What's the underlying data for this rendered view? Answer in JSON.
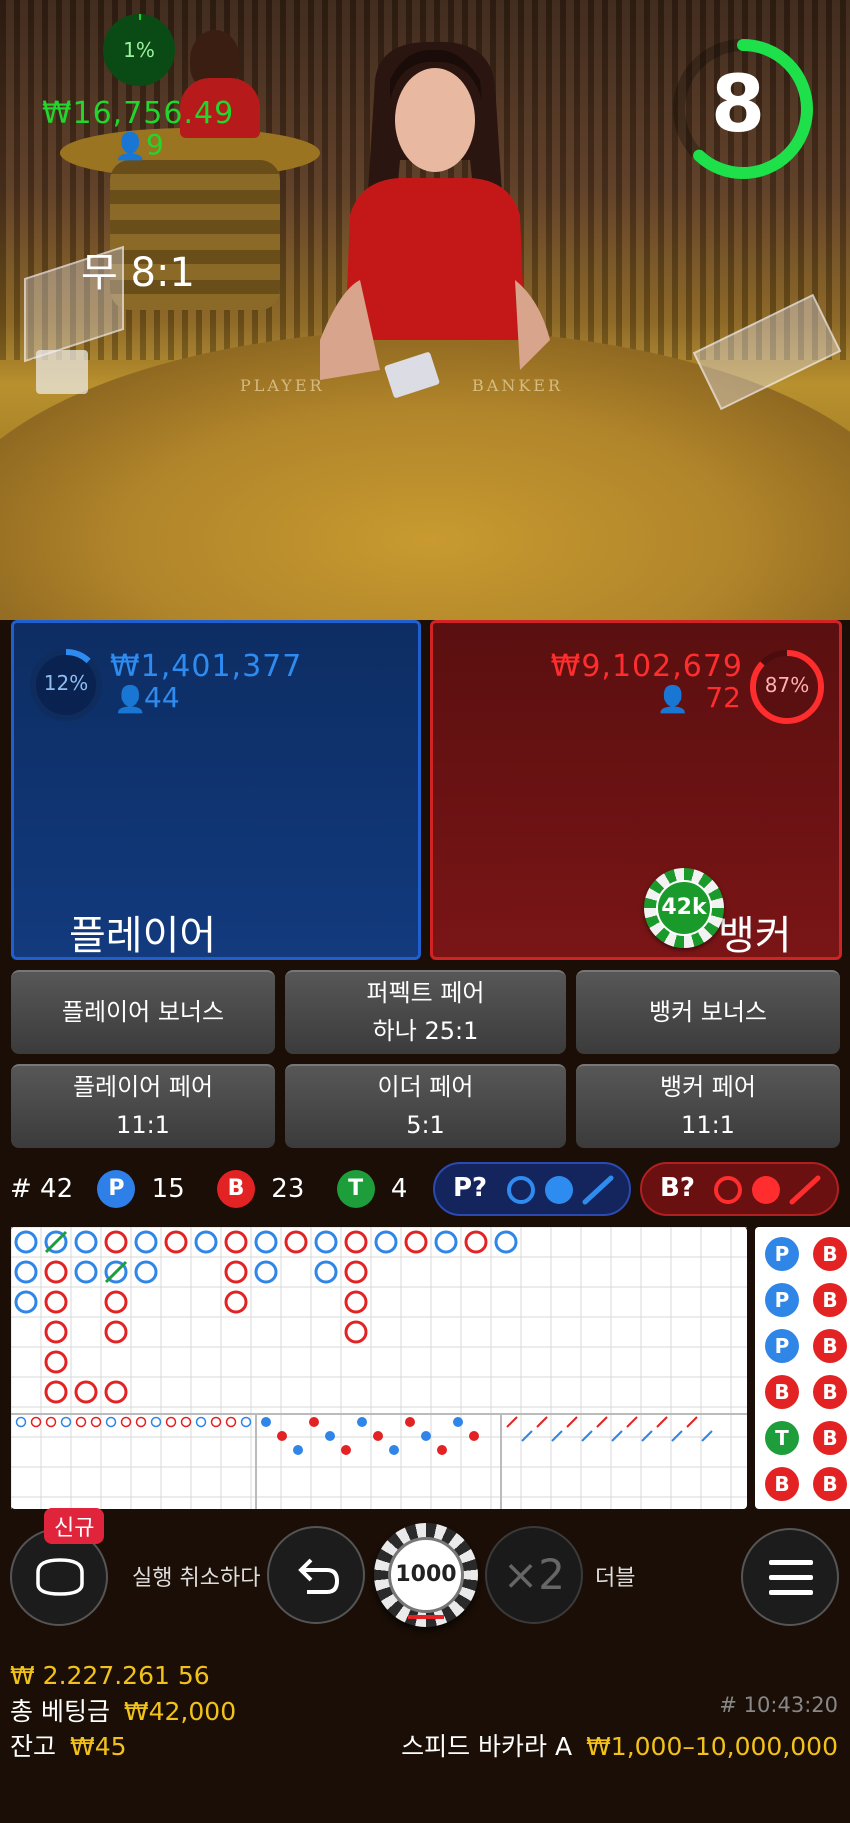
{
  "timer": {
    "value": "8",
    "fraction": 0.62
  },
  "table_print": {
    "left": "PLAYER",
    "right": "BANKER"
  },
  "player": {
    "percent": "12%",
    "percent_value": 0.12,
    "amount": "₩1,401,377",
    "count": "44",
    "label": "플레이어",
    "color": "#2e8bf0"
  },
  "tie": {
    "percent": "1%",
    "percent_value": 0.01,
    "amount": "₩16,756.49",
    "count": "9",
    "label": "무 8:1",
    "color": "#22d62b"
  },
  "banker": {
    "percent": "87%",
    "percent_value": 0.87,
    "amount": "₩9,102,679",
    "count": "72",
    "label": "뱅커",
    "color": "#ff2d2d",
    "chip": "42k"
  },
  "side_bets": [
    {
      "line1": "플레이어 보너스",
      "line2": ""
    },
    {
      "line1": "퍼펙트 페어",
      "line2": "하나 25:1"
    },
    {
      "line1": "뱅커 보너스",
      "line2": ""
    },
    {
      "line1": "플레이어 페어",
      "line2": "11:1"
    },
    {
      "line1": "이더 페어",
      "line2": "5:1"
    },
    {
      "line1": "뱅커 페어",
      "line2": "11:1"
    }
  ],
  "stats": {
    "round": "# 42",
    "p_label": "P",
    "p": "15",
    "b_label": "B",
    "b": "23",
    "t_label": "T",
    "t": "4"
  },
  "predict": {
    "player": "P?",
    "banker": "B?"
  },
  "big_road_side": [
    "P",
    "P",
    "P",
    "B",
    "T",
    "B"
  ],
  "controls": {
    "new_badge": "신규",
    "undo_label": "실행 취소하다",
    "chip": "1000",
    "double_symbol": "×2",
    "double_label": "더블"
  },
  "footer": {
    "win_amount": "₩ 2.227.261 56",
    "total_bet_label": "총 베팅금",
    "total_bet": "₩42,000",
    "balance_label": "잔고",
    "balance": "₩45",
    "round_time": "# 10:43:20",
    "table_name": "스피드 바카라 A",
    "limits": "₩1,000–10,000,000"
  },
  "colors": {
    "player": "#2e8bf0",
    "banker": "#ff2d2d",
    "tie": "#22d62b",
    "road_red": "#e32323",
    "road_blue": "#2f86e6",
    "road_green": "#1e9e3a"
  }
}
